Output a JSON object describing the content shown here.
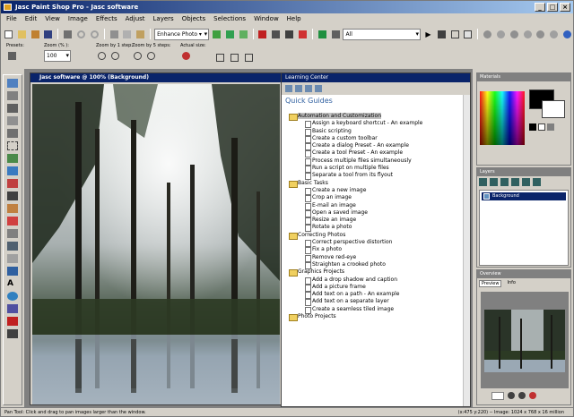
{
  "window": {
    "title": "Jasc Paint Shop Pro - Jasc software"
  },
  "menu": [
    "File",
    "Edit",
    "View",
    "Image",
    "Effects",
    "Adjust",
    "Layers",
    "Objects",
    "Selections",
    "Window",
    "Help"
  ],
  "toolbar": {
    "enhance_label": "Enhance Photo ▾",
    "search_value": "All"
  },
  "options": {
    "presets": "Presets:",
    "zoom_in_out": "Zoom (% ):",
    "zoom_in_1": "Zoom by 1 step:",
    "zoom_5": "Zoom by 5 steps:",
    "actual_size": "Actual size:",
    "zoom_value": "100"
  },
  "image_window": {
    "title": "Jasc software @ 100% (Background)"
  },
  "learning_center": {
    "title": "Learning Center",
    "heading": "Quick Guides",
    "tree": [
      {
        "type": "cat",
        "label": "Automation and Customization",
        "selected": true
      },
      {
        "type": "item",
        "label": "Assign a keyboard shortcut - An example"
      },
      {
        "type": "item",
        "label": "Basic scripting"
      },
      {
        "type": "item",
        "label": "Create a custom toolbar"
      },
      {
        "type": "item",
        "label": "Create a dialog Preset - An example"
      },
      {
        "type": "item",
        "label": "Create a tool Preset - An example"
      },
      {
        "type": "item",
        "label": "Process multiple files simultaneously"
      },
      {
        "type": "item",
        "label": "Run a script on multiple files"
      },
      {
        "type": "item",
        "label": "Separate a tool from its flyout"
      },
      {
        "type": "cat",
        "label": "Basic Tasks"
      },
      {
        "type": "item",
        "label": "Create a new image"
      },
      {
        "type": "item",
        "label": "Crop an image"
      },
      {
        "type": "item",
        "label": "E-mail an image"
      },
      {
        "type": "item",
        "label": "Open a saved image"
      },
      {
        "type": "item",
        "label": "Resize an image"
      },
      {
        "type": "item",
        "label": "Rotate a photo"
      },
      {
        "type": "cat",
        "label": "Correcting Photos"
      },
      {
        "type": "item",
        "label": "Correct perspective distortion"
      },
      {
        "type": "item",
        "label": "Fix a photo"
      },
      {
        "type": "item",
        "label": "Remove red-eye"
      },
      {
        "type": "item",
        "label": "Straighten a crooked photo"
      },
      {
        "type": "cat",
        "label": "Graphics Projects"
      },
      {
        "type": "item",
        "label": "Add a drop shadow and caption"
      },
      {
        "type": "item",
        "label": "Add a picture frame"
      },
      {
        "type": "item",
        "label": "Add text on a path - An example"
      },
      {
        "type": "item",
        "label": "Add text on a separate layer"
      },
      {
        "type": "item",
        "label": "Create a seamless tiled image"
      },
      {
        "type": "cat",
        "label": "Photo Projects"
      }
    ]
  },
  "palettes": {
    "materials": "Materials",
    "layers": "Layers",
    "layer_name": "Background",
    "overview": "Overview",
    "overview_tab1": "Preview",
    "overview_tab2": "Info"
  },
  "statusbar": {
    "left": "Pan Tool: Click and drag to pan images larger than the window.",
    "right": "(x:475 y:220) -- Image: 1024 x 768 x 16 million"
  },
  "colors": {
    "titlebar": "#0a246a",
    "accent": "#3060a0",
    "chrome": "#d4d0c8"
  }
}
